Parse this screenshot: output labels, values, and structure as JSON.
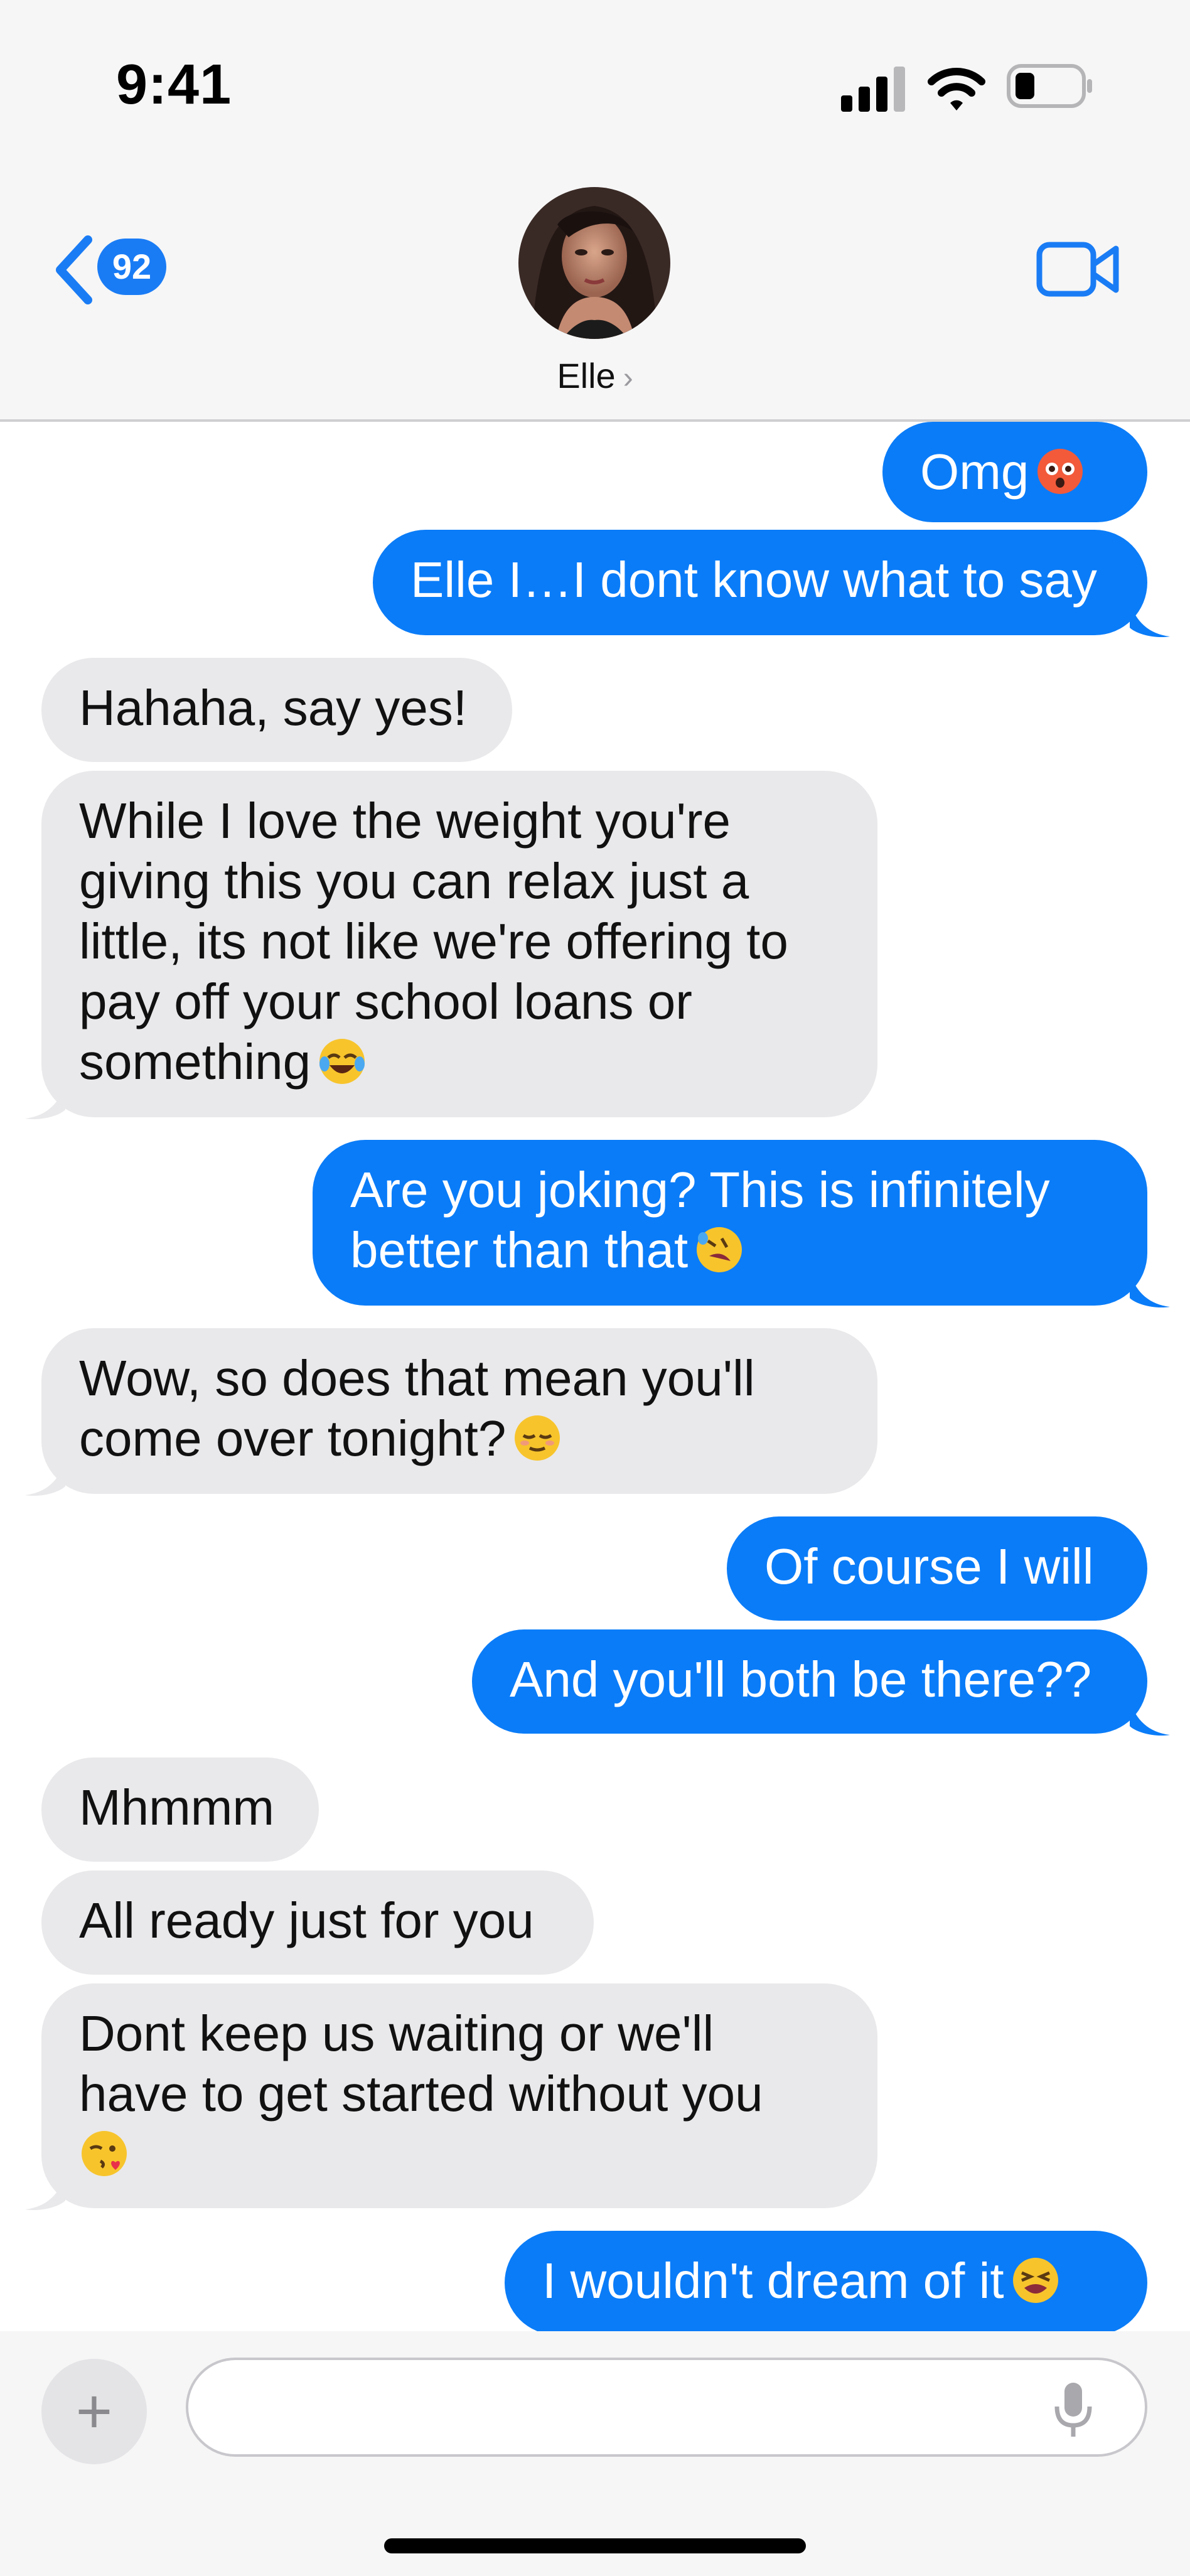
{
  "status": {
    "time": "9:41"
  },
  "header": {
    "unread_count": "92",
    "contact_name": "Elle",
    "contact_chevron": "›"
  },
  "messages": [
    {
      "from": "me",
      "text": "Omg",
      "emoji": "flushed-face"
    },
    {
      "from": "me",
      "text": "Elle I…I dont know what to say"
    },
    {
      "from": "them",
      "text": "Hahaha, say yes!"
    },
    {
      "from": "them",
      "lines": [
        "While I love the weight you're",
        "giving this you can relax just a",
        "little, its not like we're offering to",
        "pay off your school loans or",
        "something"
      ],
      "emoji": "tears-of-joy-face"
    },
    {
      "from": "me",
      "lines": [
        "Are you joking? This is infinitely",
        "better than that"
      ],
      "emoji": "rofl-face"
    },
    {
      "from": "them",
      "lines": [
        "Wow, so does that mean you'll",
        "come over tonight?"
      ],
      "emoji": "relieved-face"
    },
    {
      "from": "me",
      "text": "Of course I will"
    },
    {
      "from": "me",
      "text": "And you'll both be there??"
    },
    {
      "from": "them",
      "text": "Mhmmm"
    },
    {
      "from": "them",
      "text": "All ready just for you"
    },
    {
      "from": "them",
      "lines": [
        "Dont keep us waiting or we'll",
        "have to get started without you"
      ],
      "emoji": "kissing-face"
    },
    {
      "from": "me",
      "text": "I wouldn't dream of it",
      "emoji": "tired-face"
    }
  ],
  "input": {
    "placeholder": ""
  },
  "colors": {
    "sent": "#0a7cf8",
    "received": "#e9e9eb",
    "accent": "#1a7cf5"
  }
}
